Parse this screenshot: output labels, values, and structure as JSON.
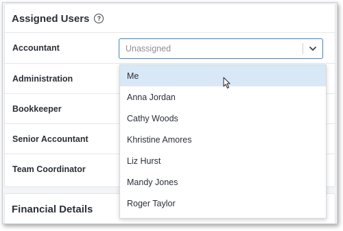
{
  "assigned_users": {
    "title": "Assigned Users",
    "help_icon": "question-circle-icon",
    "roles": [
      {
        "label": "Accountant"
      },
      {
        "label": "Administration"
      },
      {
        "label": "Bookkeeper"
      },
      {
        "label": "Senior Accountant"
      },
      {
        "label": "Team Coordinator"
      }
    ],
    "accountant_select": {
      "value": "Unassigned",
      "chevron_icon": "chevron-down-icon",
      "options": [
        "Me",
        "Anna Jordan",
        "Cathy Woods",
        "Khristine Amores",
        "Liz Hurst",
        "Mandy Jones",
        "Roger Taylor"
      ],
      "highlighted": "Me"
    }
  },
  "financial_details": {
    "title": "Financial Details"
  },
  "colors": {
    "focus_border": "#3b82c4",
    "highlight": "#d9e8f7",
    "text": "#2b2f36",
    "placeholder": "#8a8f97"
  }
}
